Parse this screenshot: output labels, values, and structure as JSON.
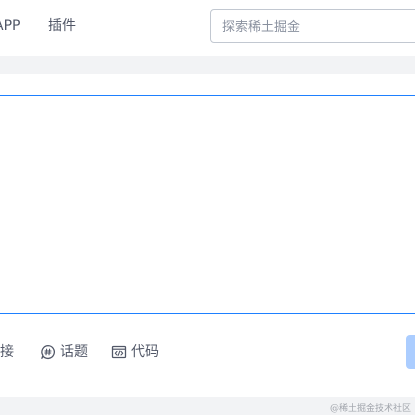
{
  "header": {
    "nav": [
      {
        "label": "APP"
      },
      {
        "label": "插件"
      }
    ],
    "search": {
      "placeholder": "探索稀土掘金",
      "value": ""
    }
  },
  "composer": {
    "textarea_value": "",
    "toolbar": [
      {
        "label": "接",
        "icon": "link-icon"
      },
      {
        "label": "话题",
        "icon": "topic-icon"
      },
      {
        "label": "代码",
        "icon": "code-icon"
      }
    ],
    "submit_label": ""
  },
  "watermark": "@稀土掘金技术社区",
  "colors": {
    "accent": "#1e80ff",
    "submit_disabled": "#abcdff",
    "band": "#f2f3f5",
    "text": "#515767",
    "placeholder": "#8a919f"
  }
}
